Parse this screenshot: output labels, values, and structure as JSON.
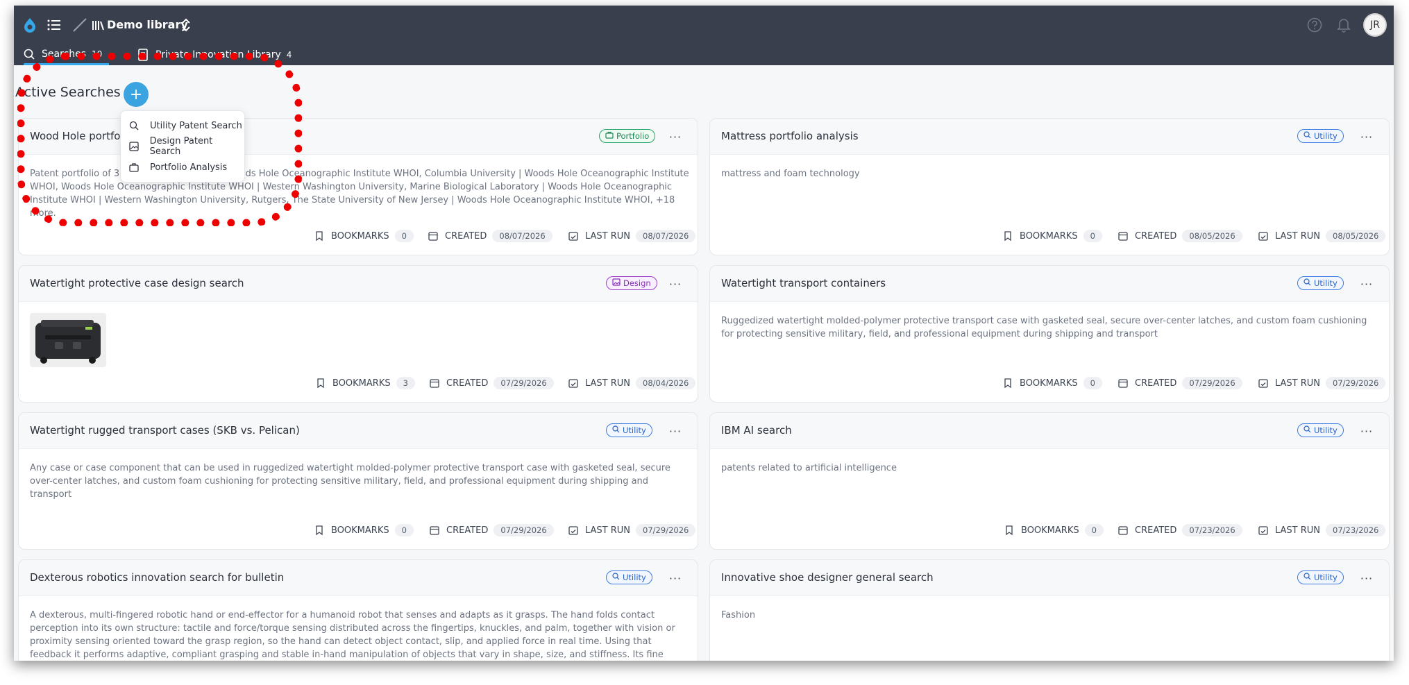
{
  "header": {
    "library_name": "Demo library",
    "avatar_initials": "JR",
    "tabs": [
      {
        "label": "Searches",
        "count": "10"
      },
      {
        "label": "Private Innovation Library",
        "count": "4"
      }
    ]
  },
  "page": {
    "title": "Active Searches",
    "add_label": "+"
  },
  "dropdown": {
    "items": [
      "Utility Patent Search",
      "Design Patent Search",
      "Portfolio Analysis"
    ]
  },
  "labels": {
    "bookmarks": "BOOKMARKS",
    "created": "CREATED",
    "last_run": "LAST RUN",
    "more": "···"
  },
  "cards": [
    {
      "title": "Wood Hole portfolio",
      "badge": "Portfolio",
      "description": "Patent portfolio of 339 patents assigned to Woods Hole Oceanographic Institute WHOI, Columbia University | Woods Hole Oceanographic Institute WHOI, Woods Hole Oceanographic Institute WHOI | Western Washington University, Marine Biological Laboratory | Woods Hole Oceanographic Institute WHOI | Western Washington University, Rutgers, The State University of New Jersey | Woods Hole Oceanographic Institute WHOI, +18 more.",
      "bookmarks": "0",
      "created": "08/07/2026",
      "last_run": "08/07/2026"
    },
    {
      "title": "Mattress portfolio analysis",
      "badge": "Utility",
      "description": "mattress and foam technology",
      "bookmarks": "0",
      "created": "08/05/2026",
      "last_run": "08/05/2026"
    },
    {
      "title": "Watertight protective case design search",
      "badge": "Design",
      "description": "",
      "bookmarks": "3",
      "created": "07/29/2026",
      "last_run": "08/04/2026"
    },
    {
      "title": "Watertight transport containers",
      "badge": "Utility",
      "description": "Ruggedized watertight molded-polymer protective transport case with gasketed seal, secure over-center latches, and custom foam cushioning for protecting sensitive military, field, and professional equipment during shipping and transport",
      "bookmarks": "0",
      "created": "07/29/2026",
      "last_run": "07/29/2026"
    },
    {
      "title": "Watertight rugged transport cases (SKB vs. Pelican)",
      "badge": "Utility",
      "description": "Any case or case component that can be used in ruggedized watertight molded-polymer protective transport case with gasketed seal, secure over-center latches, and custom foam cushioning for protecting sensitive military, field, and professional equipment during shipping and transport",
      "bookmarks": "0",
      "created": "07/29/2026",
      "last_run": "07/29/2026"
    },
    {
      "title": "IBM AI search",
      "badge": "Utility",
      "description": "patents related to artificial intelligence",
      "bookmarks": "0",
      "created": "07/23/2026",
      "last_run": "07/23/2026"
    },
    {
      "title": "Dexterous robotics innovation search for bulletin",
      "badge": "Utility",
      "description": "A dexterous, multi-fingered robotic hand or end-effector for a humanoid robot that senses and adapts as it grasps. The hand folds contact perception into its own structure: tactile and force/torque sensing distributed across the fingertips, knuckles, and palm, together with vision or proximity sensing oriented toward the grasp region, so the hand can detect object contact, slip, and applied force in real time. Using that feedback it performs adaptive, compliant grasping and stable in-hand manipulation of objects that vary in shape, size, and stiffness. Its fine motor control is learned from or refined by human...",
      "bookmarks": "",
      "created": "",
      "last_run": ""
    },
    {
      "title": "Innovative shoe designer general search",
      "badge": "Utility",
      "description": "Fashion",
      "bookmarks": "",
      "created": "",
      "last_run": ""
    }
  ]
}
